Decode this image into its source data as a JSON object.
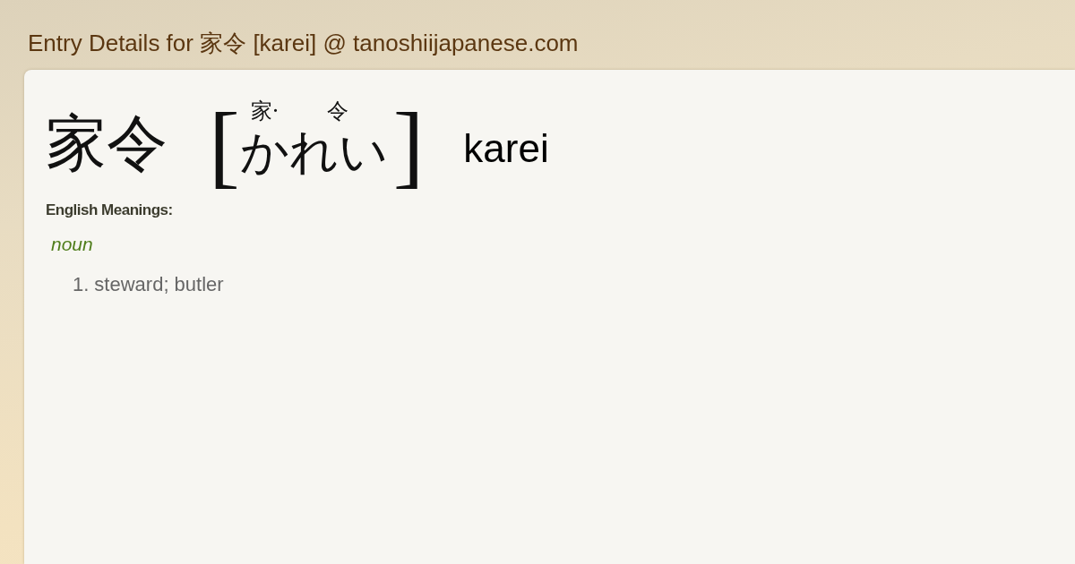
{
  "page": {
    "title": "Entry Details for 家令 [karei] @ tanoshiijapanese.com"
  },
  "entry": {
    "word": "家令",
    "reading": {
      "open": "[",
      "furigana": [
        "家·",
        "令"
      ],
      "kana": "かれい",
      "close": "]"
    },
    "romaji": "karei"
  },
  "meanings": {
    "heading": "English Meanings:",
    "groups": [
      {
        "part_of_speech": "noun",
        "senses": [
          {
            "number": "1.",
            "text": "steward; butler"
          }
        ]
      }
    ]
  }
}
